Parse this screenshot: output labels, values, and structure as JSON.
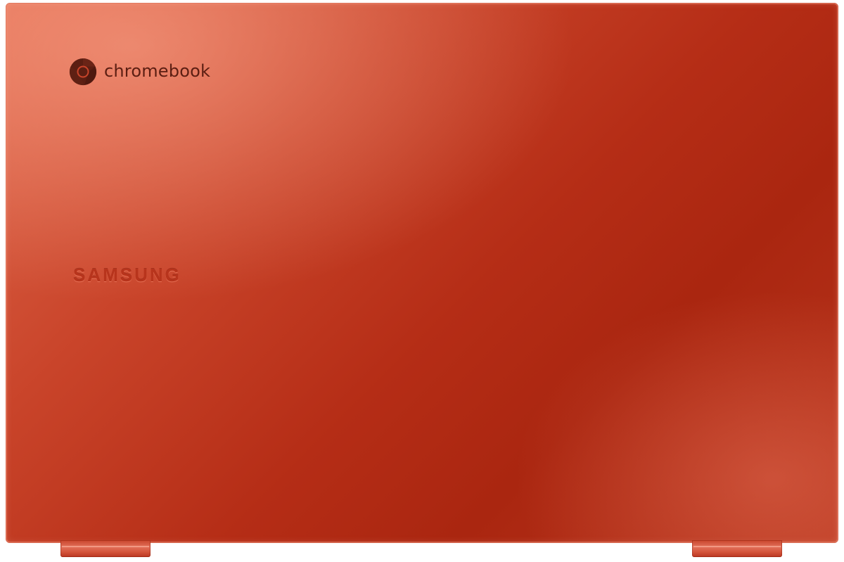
{
  "product": {
    "os_logo_text": "chromebook",
    "brand_text": "SAMSUNG",
    "icons": {
      "os_logo": "chrome-logo-icon"
    },
    "colors": {
      "lid_primary": "#b52d16",
      "lid_highlight": "#e0684c",
      "logo_text": "#5b1e12",
      "brand_text": "#b8341c",
      "background": "#ffffff"
    }
  }
}
